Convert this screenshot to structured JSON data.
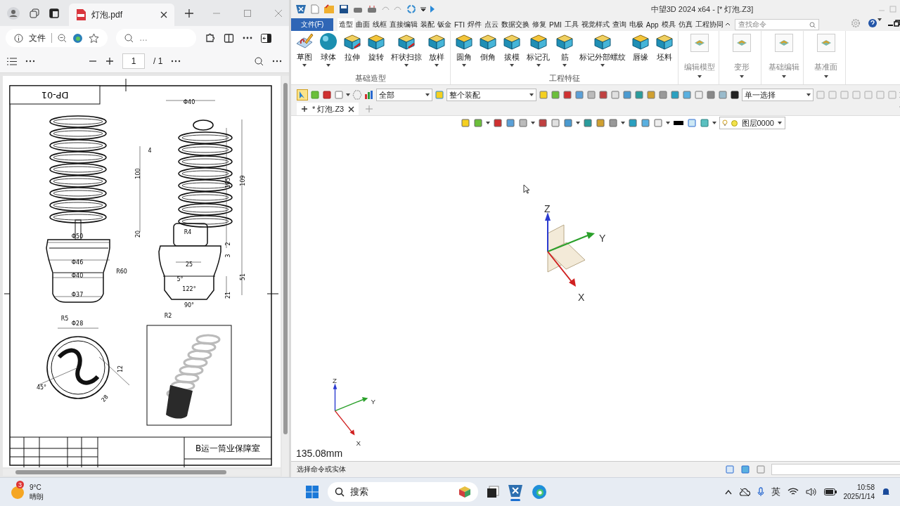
{
  "browser": {
    "tabs": [
      {
        "title": "灯泡.pdf",
        "selected": true
      }
    ],
    "address": {
      "label": "文件"
    },
    "search": {
      "value": "…"
    },
    "pdf_toolbar": {
      "page": "1",
      "total": "/ 1"
    },
    "pdf_page": {
      "title_block": "DP-01",
      "signature": "B运一筒业保障室",
      "labels": [
        {
          "text": "Φ40"
        },
        {
          "text": "4"
        },
        {
          "text": "100"
        },
        {
          "text": "105"
        },
        {
          "text": "109"
        },
        {
          "text": "20"
        },
        {
          "text": "R4"
        },
        {
          "text": "2"
        },
        {
          "text": "3"
        },
        {
          "text": "25"
        },
        {
          "text": "5°"
        },
        {
          "text": "51"
        },
        {
          "text": "122°"
        },
        {
          "text": "90°"
        },
        {
          "text": "21"
        },
        {
          "text": "R2"
        },
        {
          "text": "Φ50"
        },
        {
          "text": "Φ46"
        },
        {
          "text": "R60"
        },
        {
          "text": "Φ40"
        },
        {
          "text": "Φ37"
        },
        {
          "text": "R5"
        },
        {
          "text": "Φ28"
        },
        {
          "text": "45°"
        },
        {
          "text": "12"
        },
        {
          "text": "28"
        }
      ]
    }
  },
  "cad": {
    "window": {
      "title": "中望3D 2024 x64 - [* 灯泡.Z3]"
    },
    "file_menu": "文件(F)",
    "menu_tabs": [
      {
        "label": "造型",
        "selected": true
      },
      {
        "label": "曲面",
        "selected": false
      },
      {
        "label": "线框",
        "selected": false
      },
      {
        "label": "直接编辑",
        "selected": false
      },
      {
        "label": "装配",
        "selected": false
      },
      {
        "label": "钣金",
        "selected": false
      },
      {
        "label": "FTI",
        "selected": false
      },
      {
        "label": "焊件",
        "selected": false
      },
      {
        "label": "点云",
        "selected": false
      },
      {
        "label": "数据交换",
        "selected": false
      },
      {
        "label": "修复",
        "selected": false
      },
      {
        "label": "PMI",
        "selected": false
      },
      {
        "label": "工具",
        "selected": false
      },
      {
        "label": "视觉样式",
        "selected": false
      },
      {
        "label": "查询",
        "selected": false
      },
      {
        "label": "电极",
        "selected": false
      },
      {
        "label": "App",
        "selected": false
      },
      {
        "label": "模具",
        "selected": false
      },
      {
        "label": "仿真",
        "selected": false
      },
      {
        "label": "工程协同",
        "selected": false
      }
    ],
    "search": {
      "placeholder": "查找命令"
    },
    "ribbon": {
      "groups": [
        {
          "label": "基础造型",
          "tools": [
            {
              "label": "草图",
              "has_menu": true
            },
            {
              "label": "球体",
              "has_menu": true
            },
            {
              "label": "拉伸",
              "has_menu": false
            },
            {
              "label": "旋转",
              "has_menu": false
            },
            {
              "label": "杆状扫掠",
              "has_menu": true
            },
            {
              "label": "放样",
              "has_menu": true
            }
          ]
        },
        {
          "label": "工程特征",
          "tools": [
            {
              "label": "圆角",
              "has_menu": true
            },
            {
              "label": "倒角",
              "has_menu": false
            },
            {
              "label": "拔模",
              "has_menu": true
            },
            {
              "label": "标记孔",
              "has_menu": true
            },
            {
              "label": "筋",
              "has_menu": true
            },
            {
              "label": "标记外部螺纹",
              "has_menu": true
            },
            {
              "label": "唇缘",
              "has_menu": false
            },
            {
              "label": "坯料",
              "has_menu": false
            }
          ]
        }
      ],
      "panels": [
        {
          "label": "编辑模型",
          "disabled": true
        },
        {
          "label": "变形",
          "disabled": true
        },
        {
          "label": "基础编辑",
          "disabled": true
        },
        {
          "label": "基准面",
          "disabled": true
        }
      ]
    },
    "toolbar": {
      "filter": "全部",
      "scope": "整个装配",
      "select_mode": "单一选择"
    },
    "doc_tabs": [
      {
        "label": "* 灯泡.Z3",
        "selected": true
      }
    ],
    "layer": "图层0000",
    "viewport": {
      "axes": [
        "Z",
        "Y",
        "X"
      ],
      "mini_axes": [
        "Z",
        "Y",
        "X"
      ],
      "measure": "135.08mm"
    },
    "status_bar": {
      "prompt": "选择命令或实体"
    }
  },
  "taskbar": {
    "weather": {
      "badge": "3",
      "temp": "9°C",
      "condition": "晴朗"
    },
    "search": {
      "placeholder": "搜索"
    },
    "ime": "英",
    "time": "10:58",
    "date": "2025/1/14"
  }
}
